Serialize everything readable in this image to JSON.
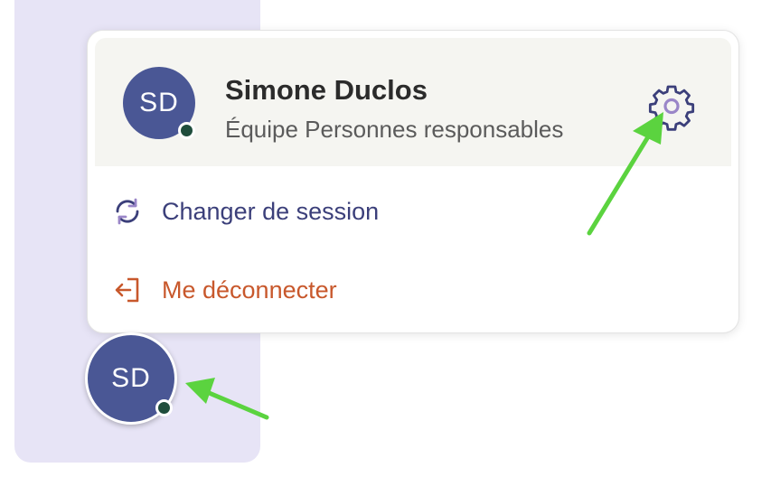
{
  "profile": {
    "initials": "SD",
    "name": "Simone Duclos",
    "team": "Équipe Personnes responsables",
    "presence": "online",
    "avatar_color": "#4a5795",
    "presence_color": "#1f4d3c"
  },
  "menu": {
    "switch_session_label": "Changer de session",
    "logout_label": "Me déconnecter"
  },
  "icons": {
    "settings": "gear-icon",
    "switch_session": "refresh-icon",
    "logout": "logout-icon"
  },
  "sidebar": {
    "avatar_initials": "SD"
  },
  "colors": {
    "sidebar_bg": "#e7e4f6",
    "header_bg": "#f5f5f1",
    "switch_text": "#3b3f7a",
    "logout_text": "#c8582c",
    "annotation_arrow": "#5bd33f"
  }
}
